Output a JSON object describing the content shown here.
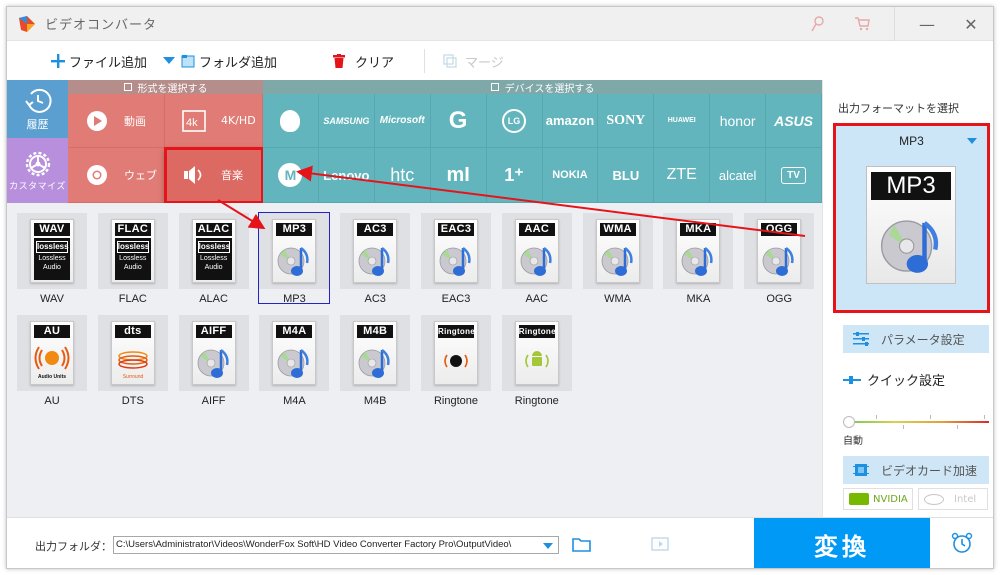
{
  "window": {
    "title": "ビデオコンバータ",
    "icons": [
      "key-icon",
      "cart-icon"
    ],
    "minimize": "—",
    "close": "✕"
  },
  "toolbar": {
    "add_file": "ファイル追加",
    "add_folder": "フォルダ追加",
    "clear": "クリア",
    "merge": "マージ"
  },
  "sidebar": {
    "history": "履歴",
    "customize": "カスタマイズ"
  },
  "format_section": {
    "header": "形式を選択する",
    "items": [
      {
        "label": "動画",
        "icon": "play-icon"
      },
      {
        "label": "4K/HD",
        "icon": "4k-icon"
      },
      {
        "label": "ウェブ",
        "icon": "chrome-icon"
      },
      {
        "label": "音楽",
        "icon": "speaker-icon",
        "active": true
      }
    ]
  },
  "device_section": {
    "header": "デバイスを選択する",
    "brands_row1": [
      "Apple",
      "SAMSUNG",
      "Microsoft",
      "G",
      "LG",
      "amazon",
      "SONY",
      "HUAWEI",
      "honor",
      "ASUS"
    ],
    "brands_row2": [
      "Motorola",
      "Lenovo",
      "htc",
      "mi",
      "1+",
      "NOKIA",
      "BLU",
      "ZTE",
      "alcatel",
      "TV"
    ]
  },
  "formats": {
    "items": [
      {
        "label": "WAV",
        "badge": "WAV",
        "art": "lossless"
      },
      {
        "label": "FLAC",
        "badge": "FLAC",
        "art": "lossless"
      },
      {
        "label": "ALAC",
        "badge": "ALAC",
        "art": "lossless"
      },
      {
        "label": "MP3",
        "badge": "MP3",
        "art": "disc",
        "selected": true
      },
      {
        "label": "AC3",
        "badge": "AC3",
        "art": "disc"
      },
      {
        "label": "EAC3",
        "badge": "EAC3",
        "art": "disc"
      },
      {
        "label": "AAC",
        "badge": "AAC",
        "art": "disc"
      },
      {
        "label": "WMA",
        "badge": "WMA",
        "art": "disc"
      },
      {
        "label": "MKA",
        "badge": "MKA",
        "art": "disc"
      },
      {
        "label": "OGG",
        "badge": "OGG",
        "art": "disc"
      },
      {
        "label": "AU",
        "badge": "AU",
        "art": "au"
      },
      {
        "label": "DTS",
        "badge": "dts",
        "art": "dts"
      },
      {
        "label": "AIFF",
        "badge": "AIFF",
        "art": "disc"
      },
      {
        "label": "M4A",
        "badge": "M4A",
        "art": "disc"
      },
      {
        "label": "M4B",
        "badge": "M4B",
        "art": "disc"
      },
      {
        "label": "Ringtone",
        "badge": "Ringtone",
        "art": "apple"
      },
      {
        "label": "Ringtone",
        "badge": "Ringtone",
        "art": "android"
      }
    ],
    "lossless_text": [
      "lossless",
      "Lossless",
      "Audio"
    ],
    "au_text": "Audio Units",
    "dts_text": "Surround"
  },
  "right_panel": {
    "title": "出力フォーマットを選択",
    "selected_format": "MP3",
    "big_badge": "MP3",
    "params_button": "パラメータ設定",
    "quick_settings": "クイック設定",
    "slider_label": "自動",
    "slider_value": 0,
    "gpu_button": "ビデオカード加速",
    "nvidia": "NVIDIA",
    "intel": "Intel"
  },
  "bottom": {
    "output_label": "出力フォルダ：",
    "output_path": "C:\\Users\\Administrator\\Videos\\WonderFox Soft\\HD Video Converter Factory Pro\\OutputVideo\\",
    "convert": "変換"
  },
  "colors": {
    "history": "#5a9fd0",
    "customize": "#b78fdc",
    "format_section": "#e07b75",
    "device_section": "#62b5bd",
    "convert": "#0199f6",
    "highlight": "#e5141a"
  }
}
